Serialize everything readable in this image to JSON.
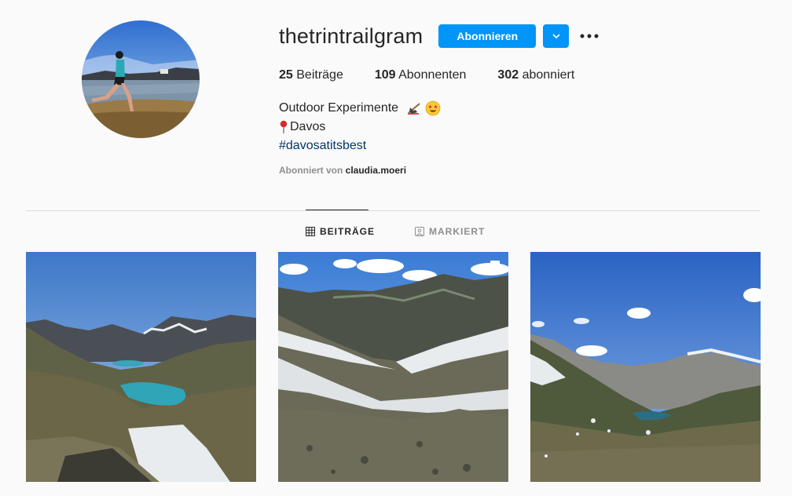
{
  "profile": {
    "username": "thetrintrailgram",
    "follow_label": "Abonnieren",
    "dropdown_icon": "chevron-down-icon",
    "more_icon": "more-options-icon"
  },
  "stats": {
    "posts_count": "25",
    "posts_label": "Beiträge",
    "followers_count": "109",
    "followers_label": "Abonnenten",
    "following_count": "302",
    "following_label": "abonniert"
  },
  "bio": {
    "line1": "Outdoor Experimente",
    "line1_emojis": [
      "boot-ski-icon",
      "star-struck-icon"
    ],
    "line2_icon": "pushpin-icon",
    "line2": "Davos",
    "hashtag": "#davosatitsbest"
  },
  "followed_by": {
    "prefix": "Abonniert von",
    "user": "claudia.moeri"
  },
  "tabs": [
    {
      "label": "BEITRÄGE",
      "icon": "grid-icon",
      "active": true
    },
    {
      "label": "MARKIERT",
      "icon": "tagged-icon",
      "active": false
    }
  ],
  "colors": {
    "accent": "#0095f6",
    "hashtag": "#00376b",
    "muted": "#8e8e8e",
    "background": "#fafafa"
  }
}
